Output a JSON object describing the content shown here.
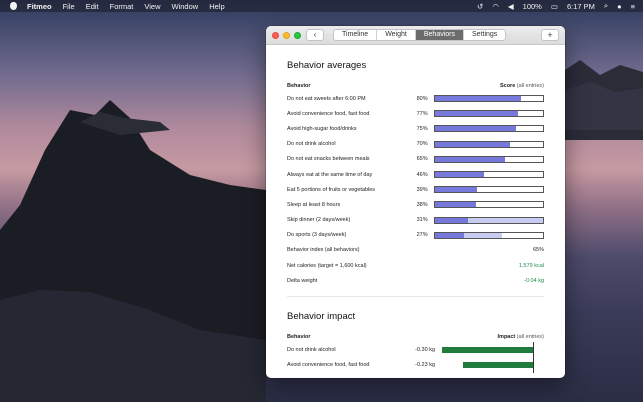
{
  "menubar": {
    "app_name": "Fitmeo",
    "menus": [
      "File",
      "Edit",
      "Format",
      "View",
      "Window",
      "Help"
    ],
    "battery": "100%",
    "clock": "6:17 PM"
  },
  "window": {
    "tabs": [
      {
        "label": "Timeline",
        "active": false
      },
      {
        "label": "Weight",
        "active": false
      },
      {
        "label": "Behaviors",
        "active": true
      },
      {
        "label": "Settings",
        "active": false
      }
    ],
    "back_label": "‹",
    "add_label": "+"
  },
  "averages": {
    "title": "Behavior averages",
    "col_behavior": "Behavior",
    "col_score": "Score",
    "col_score_note": "(all entries)",
    "rows": [
      {
        "label": "Do not eat sweets after 6:00 PM",
        "pct": "80%",
        "value": 0.8,
        "secondary": 0.8
      },
      {
        "label": "Avoid convenience food, fast food",
        "pct": "77%",
        "value": 0.77,
        "secondary": 0.77
      },
      {
        "label": "Avoid high-sugar food/drinks",
        "pct": "75%",
        "value": 0.75,
        "secondary": 0.75
      },
      {
        "label": "Do not drink alcohol",
        "pct": "70%",
        "value": 0.7,
        "secondary": 0.7
      },
      {
        "label": "Do not eat snacks between meals",
        "pct": "65%",
        "value": 0.65,
        "secondary": 0.65
      },
      {
        "label": "Always eat at the same time of day",
        "pct": "46%",
        "value": 0.46,
        "secondary": 0.46
      },
      {
        "label": "Eat 5 portions of fruits or vegetables",
        "pct": "39%",
        "value": 0.39,
        "secondary": 0.39
      },
      {
        "label": "Sleep at least 8 hours",
        "pct": "38%",
        "value": 0.38,
        "secondary": 0.38
      },
      {
        "label": "Skip dinner (2 days/week)",
        "pct": "31%",
        "value": 0.31,
        "secondary": 1.0
      },
      {
        "label": "Do sports (3 days/week)",
        "pct": "27%",
        "value": 0.27,
        "secondary": 0.62
      }
    ],
    "stats": [
      {
        "label": "Behavior index (all behaviors)",
        "value": "65%",
        "green": false
      },
      {
        "label": "Net calories (target = 1,600 kcal)",
        "value": "1,579 kcal",
        "green": true
      },
      {
        "label": "Delta weight",
        "value": "-0.04 kg",
        "green": true
      }
    ]
  },
  "impact": {
    "title": "Behavior impact",
    "col_behavior": "Behavior",
    "col_impact": "Impact",
    "col_impact_note": "(all entries)",
    "rows": [
      {
        "label": "Do not drink alcohol",
        "value_text": "-0.30 kg",
        "value": -0.3
      },
      {
        "label": "Avoid convenience food, fast food",
        "value_text": "-0.23 kg",
        "value": -0.23
      }
    ],
    "max_abs": 0.3
  },
  "colors": {
    "bar_primary": "#7678dc",
    "bar_secondary": "#c9ccf2",
    "impact_bar": "#1f7c3c",
    "positive_text": "#1f8a4a"
  }
}
